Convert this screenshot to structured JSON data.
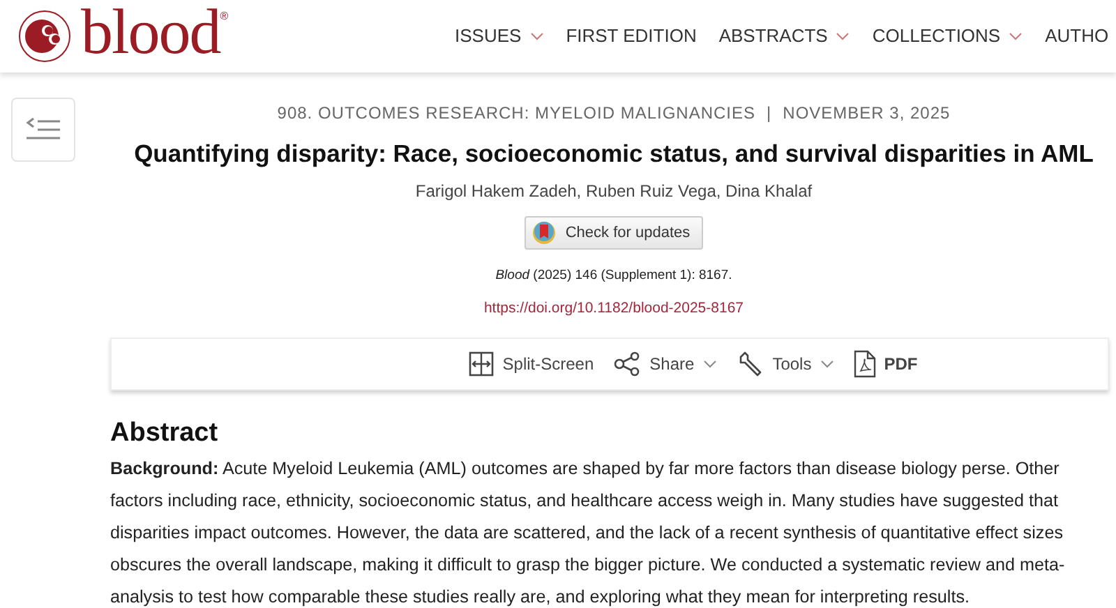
{
  "header": {
    "logo_text": "blood",
    "logo_mark": "®",
    "nav": [
      {
        "label": "ISSUES",
        "has_menu": true
      },
      {
        "label": "FIRST EDITION",
        "has_menu": false
      },
      {
        "label": "ABSTRACTS",
        "has_menu": true
      },
      {
        "label": "COLLECTIONS",
        "has_menu": true
      },
      {
        "label": "AUTHO",
        "has_menu": false
      }
    ]
  },
  "article": {
    "category": "908. OUTCOMES RESEARCH: MYELOID MALIGNANCIES",
    "separator": "|",
    "date": "NOVEMBER 3, 2025",
    "title": "Quantifying disparity: Race, socioeconomic status, and survival disparities in AML",
    "authors": "Farigol Hakem Zadeh, Ruben Ruiz Vega, Dina Khalaf",
    "updates_button": "Check for updates",
    "citation": "*Blood* (2025) 146 (Supplement 1): 8167.",
    "doi": "https://doi.org/10.1182/blood-2025-8167"
  },
  "toolbar": [
    {
      "kind": "split",
      "label": "Split-Screen",
      "has_menu": false
    },
    {
      "kind": "share",
      "label": "Share",
      "has_menu": true
    },
    {
      "kind": "tools",
      "label": "Tools",
      "has_menu": true
    },
    {
      "kind": "pdf",
      "label": "PDF",
      "has_menu": false
    }
  ],
  "abstract": {
    "heading": "Abstract",
    "text": "**Background:** Acute Myeloid Leukemia (AML) outcomes are shaped by far more factors than disease biology perse. Other factors including race, ethnicity, socioeconomic status, and healthcare access weigh in. Many studies have suggested that disparities impact outcomes. However, the data are scattered, and the lack of a recent synthesis of quantitative effect sizes obscures the overall landscape, making it difficult to grasp the bigger picture. We conducted a systematic review and meta-analysis to test how comparable these studies really are, and exploring what they mean for interpreting results."
  }
}
